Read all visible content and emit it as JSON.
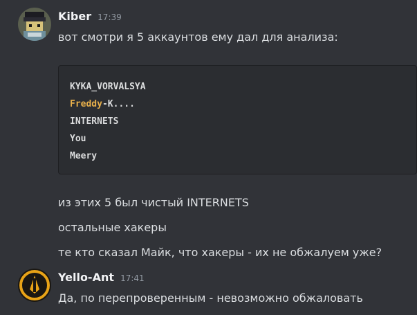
{
  "messages": [
    {
      "username": "Kiber",
      "time": "17:39",
      "text": "вот смотри я 5 аккаунтов ему дал для анализа:",
      "code_lines": [
        {
          "pre": "KYKA_VORVALSYA",
          "accent": "",
          "post": ""
        },
        {
          "pre": "",
          "accent": "Freddy",
          "post": "-K...."
        },
        {
          "pre": "INTERNETS",
          "accent": "",
          "post": ""
        },
        {
          "pre": "You",
          "accent": "",
          "post": ""
        },
        {
          "pre": "Meery",
          "accent": "",
          "post": ""
        }
      ],
      "followups": [
        "из этих 5 был чистый INTERNETS",
        "остальные хакеры",
        "те кто сказал Майк, что хакеры - их не обжалуем уже?"
      ]
    },
    {
      "username": "Yello-Ant",
      "time": "17:41",
      "text": "Да, по перепроверенным - невозможно обжаловать"
    }
  ],
  "colors": {
    "background": "#313338",
    "codeblock_bg": "#2b2d31",
    "code_accent": "#e8b04b",
    "username": "#f2f3f5",
    "timestamp": "#949ba4"
  },
  "icons": {
    "kiber_avatar": "pixel-character-avatar",
    "yello_ant_avatar": "borderlands-vault-symbol-avatar"
  }
}
